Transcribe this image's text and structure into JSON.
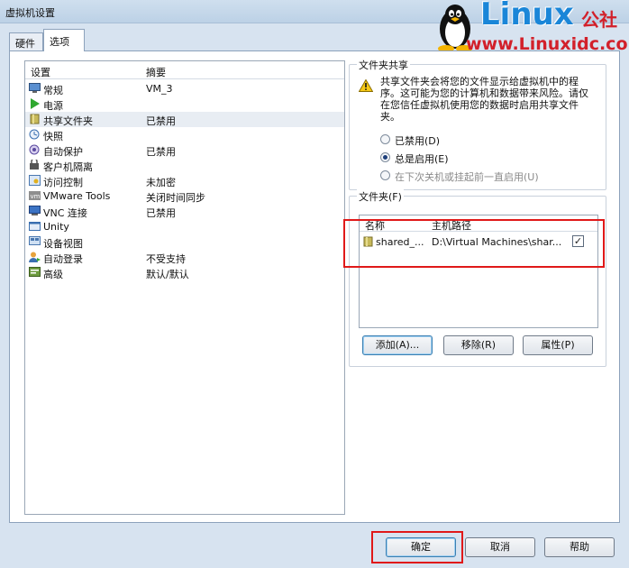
{
  "window": {
    "title": "虚拟机设置"
  },
  "watermark": {
    "brand": "Linux",
    "brand_cn": "公社",
    "url": "www.Linuxidc.com"
  },
  "tabs": [
    {
      "label": "硬件"
    },
    {
      "label": "选项"
    }
  ],
  "settings_list": {
    "header": {
      "setting": "设置",
      "summary": "摘要"
    },
    "items": [
      {
        "name": "常规",
        "summary": "VM_3",
        "icon": "monitor-icon"
      },
      {
        "name": "电源",
        "summary": "",
        "icon": "play-icon"
      },
      {
        "name": "共享文件夹",
        "summary": "已禁用",
        "icon": "shared-folder-icon"
      },
      {
        "name": "快照",
        "summary": "",
        "icon": "snapshot-icon"
      },
      {
        "name": "自动保护",
        "summary": "已禁用",
        "icon": "autoprotect-icon"
      },
      {
        "name": "客户机隔离",
        "summary": "",
        "icon": "isolation-icon"
      },
      {
        "name": "访问控制",
        "summary": "未加密",
        "icon": "access-control-icon"
      },
      {
        "name": "VMware Tools",
        "summary": "关闭时间同步",
        "icon": "vmware-tools-icon"
      },
      {
        "name": "VNC 连接",
        "summary": "已禁用",
        "icon": "vnc-icon"
      },
      {
        "name": "Unity",
        "summary": "",
        "icon": "unity-icon"
      },
      {
        "name": "设备视图",
        "summary": "",
        "icon": "device-view-icon"
      },
      {
        "name": "自动登录",
        "summary": "不受支持",
        "icon": "autologin-icon"
      },
      {
        "name": "高级",
        "summary": "默认/默认",
        "icon": "advanced-icon"
      }
    ]
  },
  "folder_sharing": {
    "title": "文件夹共享",
    "warning": "共享文件夹会将您的文件显示给虚拟机中的程序。这可能为您的计算机和数据带来风险。请仅在您信任虚拟机使用您的数据时启用共享文件夹。",
    "options": [
      {
        "label": "已禁用(D)",
        "checked": false,
        "disabled": false
      },
      {
        "label": "总是启用(E)",
        "checked": true,
        "disabled": false
      },
      {
        "label": "在下次关机或挂起前一直启用(U)",
        "checked": false,
        "disabled": true
      }
    ]
  },
  "folders": {
    "title": "文件夹(F)",
    "columns": {
      "name": "名称",
      "host_path": "主机路径"
    },
    "rows": [
      {
        "name": "shared_...",
        "path": "D:\\Virtual Machines\\shar...",
        "enabled": true
      }
    ],
    "buttons": {
      "add": "添加(A)...",
      "remove": "移除(R)",
      "properties": "属性(P)"
    }
  },
  "footer": {
    "ok": "确定",
    "cancel": "取消",
    "help": "帮助"
  },
  "colors": {
    "highlight_red": "#e01919",
    "brand_blue": "#1a86d8",
    "brand_red": "#d2202a"
  }
}
